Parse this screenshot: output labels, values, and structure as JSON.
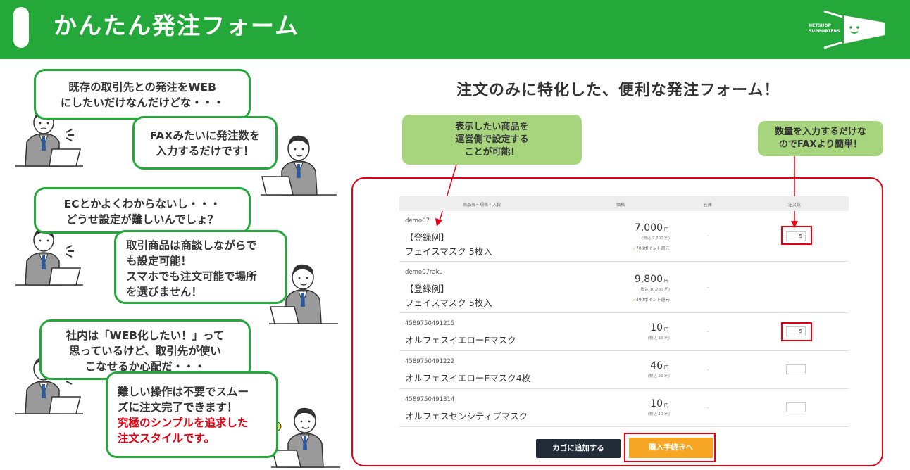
{
  "header": {
    "title": "かんたん発注フォーム",
    "logo_text": [
      "NETSHOP",
      "SUPPORTERS"
    ]
  },
  "bubbles": {
    "b1": [
      "既存の取引先との発注をWEB",
      "にしたいだけなんだけどな・・・"
    ],
    "b2": [
      "FAXみたいに発注数を",
      "入力するだけです！"
    ],
    "b3": [
      "ECとかよくわからないし・・・",
      "どうせ設定が難しいんでしょ？"
    ],
    "b4": [
      "取引商品は商談しながらで",
      "も設定可能！",
      "スマホでも注文可能で場所",
      "を選びません！"
    ],
    "b5": [
      "社内は「WEB化したい！」って",
      "思っているけど、取引先が使い",
      "こなせるか心配だ・・・"
    ],
    "b6": [
      "難しい操作は不要でスムー",
      "ズに注文完了できます！"
    ],
    "b6_red": [
      "究極のシンプルを追求した",
      "注文スタイルです。"
    ]
  },
  "main": {
    "heading": "注文のみに特化した、便利な発注フォーム！",
    "note_left": [
      "表示したい商品を",
      "運営側で設定する",
      "ことが可能！"
    ],
    "note_right": [
      "数量を入力するだけな",
      "のでFAXより簡単！"
    ]
  },
  "table": {
    "headers": [
      "商品名・規格・入数",
      "価格",
      "在庫",
      "注文数"
    ],
    "rows": [
      {
        "code": "demo07",
        "name1": "【登録例】",
        "name2": "フェイスマスク 5枚入",
        "price": "7,000",
        "unit": "円",
        "tax": "(税込 7,700 円)",
        "points": "700ポイント還元",
        "stock": "-",
        "qty": "5"
      },
      {
        "code": "demo07raku",
        "name1": "【登録例】",
        "name2": "フェイスマスク 5枚入",
        "price": "9,800",
        "unit": "円",
        "tax": "(税込 10,780 円)",
        "points": "490ポイント還元",
        "stock": "-",
        "qty": ""
      },
      {
        "code": "4589750491215",
        "name1": "",
        "name2": "オルフェスイエローEマスク",
        "price": "10",
        "unit": "円",
        "tax": "(税込 10 円)",
        "points": "",
        "stock": "-",
        "qty": "5"
      },
      {
        "code": "4589750491222",
        "name1": "",
        "name2": "オルフェスイエローEマスク4枚",
        "price": "46",
        "unit": "円",
        "tax": "(税込 50 円)",
        "points": "",
        "stock": "-",
        "qty": ""
      },
      {
        "code": "4589750491314",
        "name1": "",
        "name2": "オルフェスセンシティブマスク",
        "price": "10",
        "unit": "円",
        "tax": "(税込 10 円)",
        "points": "",
        "stock": "-",
        "qty": ""
      }
    ]
  },
  "buttons": {
    "cart": "カゴに追加する",
    "buy": "購入手続きへ"
  },
  "colors": {
    "brand_green": "#24a83a",
    "note_green": "#a7d57e",
    "highlight_red": "#e60012",
    "buy_orange": "#f6a623",
    "cart_navy": "#222b38"
  }
}
